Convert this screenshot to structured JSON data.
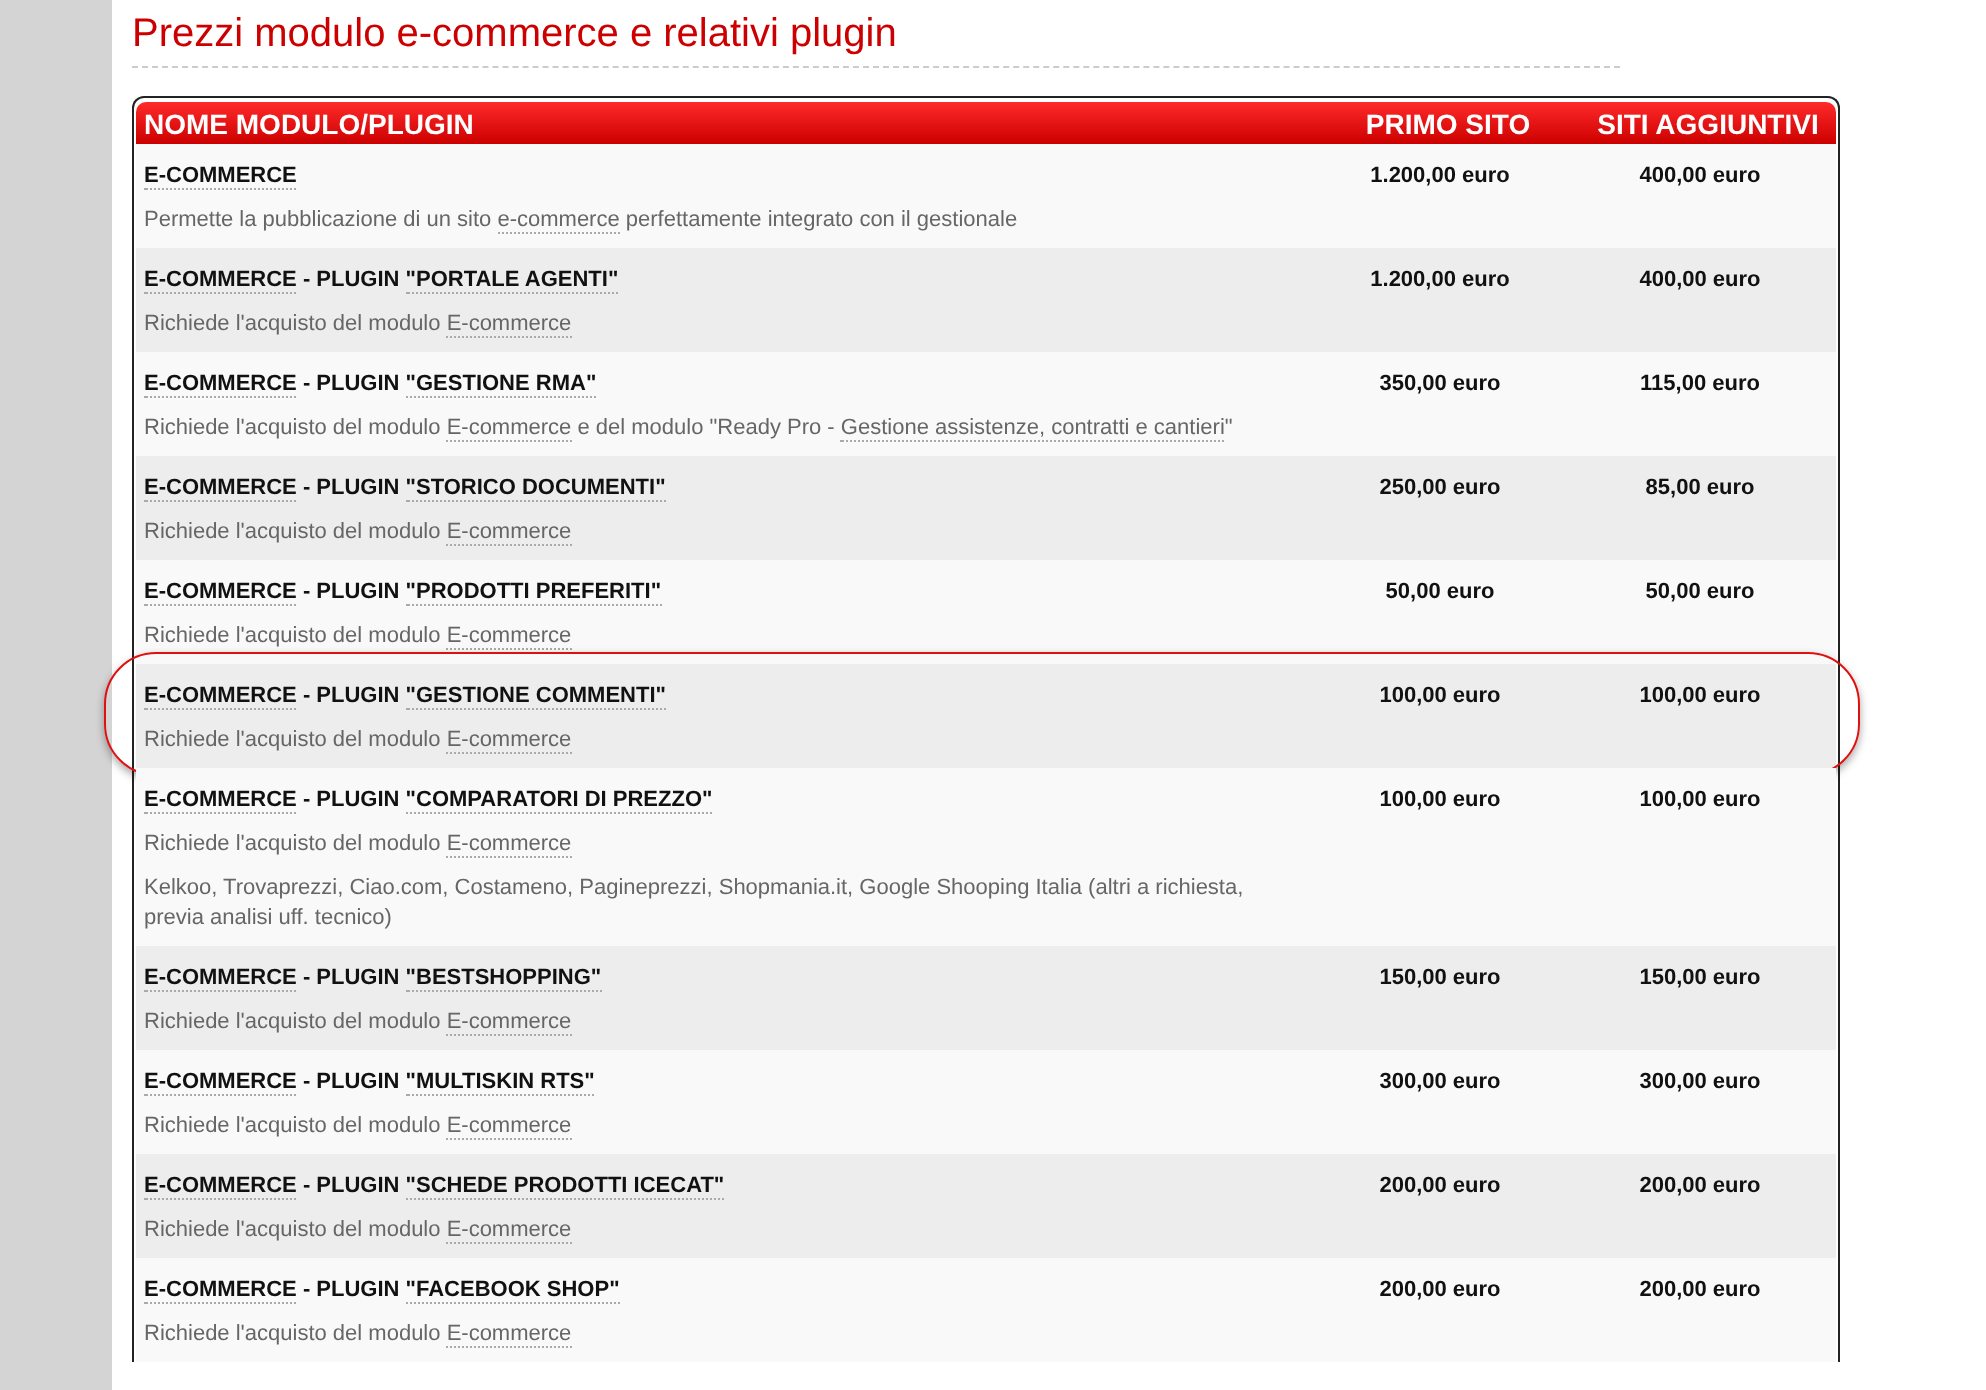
{
  "title": "Prezzi modulo e-commerce e relativi plugin",
  "table": {
    "columns": [
      "NOME MODULO/PLUGIN",
      "PRIMO SITO",
      "SITI AGGIUNTIVI"
    ],
    "rows": [
      {
        "name": [
          {
            "text": "E-COMMERCE",
            "link": true
          }
        ],
        "lines": [
          [
            {
              "text": "Permette la pubblicazione di un sito ",
              "link": false
            },
            {
              "text": "e-commerce",
              "link": true
            },
            {
              "text": " perfettamente integrato con il gestionale",
              "link": false
            }
          ]
        ],
        "primo_sito": "1.200,00 euro",
        "siti_aggiuntivi": "400,00 euro",
        "highlighted": false
      },
      {
        "name": [
          {
            "text": "E-COMMERCE",
            "link": true
          },
          {
            "text": " - PLUGIN ",
            "link": false
          },
          {
            "text": "\"PORTALE AGENTI\"",
            "link": true
          }
        ],
        "lines": [
          [
            {
              "text": "Richiede l'acquisto del modulo ",
              "link": false
            },
            {
              "text": "E-commerce",
              "link": true
            }
          ]
        ],
        "primo_sito": "1.200,00 euro",
        "siti_aggiuntivi": "400,00 euro",
        "highlighted": false
      },
      {
        "name": [
          {
            "text": "E-COMMERCE",
            "link": true
          },
          {
            "text": " - PLUGIN ",
            "link": false
          },
          {
            "text": "\"GESTIONE RMA\"",
            "link": true
          }
        ],
        "lines": [
          [
            {
              "text": "Richiede l'acquisto del modulo ",
              "link": false
            },
            {
              "text": "E-commerce",
              "link": true
            },
            {
              "text": " e del modulo \"Ready Pro - ",
              "link": false
            },
            {
              "text": "Gestione assistenze, contratti e cantieri",
              "link": true
            },
            {
              "text": "\"",
              "link": false
            }
          ]
        ],
        "primo_sito": "350,00 euro",
        "siti_aggiuntivi": "115,00 euro",
        "highlighted": false
      },
      {
        "name": [
          {
            "text": "E-COMMERCE",
            "link": true
          },
          {
            "text": " - PLUGIN ",
            "link": false
          },
          {
            "text": "\"STORICO DOCUMENTI\"",
            "link": true
          }
        ],
        "lines": [
          [
            {
              "text": "Richiede l'acquisto del modulo ",
              "link": false
            },
            {
              "text": "E-commerce",
              "link": true
            }
          ]
        ],
        "primo_sito": "250,00 euro",
        "siti_aggiuntivi": "85,00 euro",
        "highlighted": false
      },
      {
        "name": [
          {
            "text": "E-COMMERCE",
            "link": true
          },
          {
            "text": " - PLUGIN ",
            "link": false
          },
          {
            "text": "\"PRODOTTI PREFERITI\"",
            "link": true
          }
        ],
        "lines": [
          [
            {
              "text": "Richiede l'acquisto del modulo ",
              "link": false
            },
            {
              "text": "E-commerce",
              "link": true
            }
          ]
        ],
        "primo_sito": "50,00 euro",
        "siti_aggiuntivi": "50,00 euro",
        "highlighted": false
      },
      {
        "name": [
          {
            "text": "E-COMMERCE",
            "link": true
          },
          {
            "text": " - PLUGIN ",
            "link": false
          },
          {
            "text": "\"GESTIONE COMMENTI\"",
            "link": true
          }
        ],
        "lines": [
          [
            {
              "text": "Richiede l'acquisto del modulo ",
              "link": false
            },
            {
              "text": "E-commerce",
              "link": true
            }
          ]
        ],
        "primo_sito": "100,00 euro",
        "siti_aggiuntivi": "100,00 euro",
        "highlighted": true
      },
      {
        "name": [
          {
            "text": "E-COMMERCE",
            "link": true
          },
          {
            "text": " - PLUGIN ",
            "link": false
          },
          {
            "text": "\"COMPARATORI DI PREZZO\"",
            "link": true
          }
        ],
        "lines": [
          [
            {
              "text": "Richiede l'acquisto del modulo ",
              "link": false
            },
            {
              "text": "E-commerce",
              "link": true
            }
          ],
          [
            {
              "text": "Kelkoo, Trovaprezzi, Ciao.com, Costameno, Pagineprezzi, Shopmania.it, Google Shooping Italia (altri a richiesta, previa analisi uff. tecnico)",
              "link": false
            }
          ]
        ],
        "primo_sito": "100,00 euro",
        "siti_aggiuntivi": "100,00 euro",
        "highlighted": false
      },
      {
        "name": [
          {
            "text": "E-COMMERCE",
            "link": true
          },
          {
            "text": " - PLUGIN ",
            "link": false
          },
          {
            "text": "\"BESTSHOPPING\"",
            "link": true
          }
        ],
        "lines": [
          [
            {
              "text": "Richiede l'acquisto del modulo ",
              "link": false
            },
            {
              "text": "E-commerce",
              "link": true
            }
          ]
        ],
        "primo_sito": "150,00 euro",
        "siti_aggiuntivi": "150,00 euro",
        "highlighted": false
      },
      {
        "name": [
          {
            "text": "E-COMMERCE",
            "link": true
          },
          {
            "text": " - PLUGIN ",
            "link": false
          },
          {
            "text": "\"MULTISKIN RTS\"",
            "link": true
          }
        ],
        "lines": [
          [
            {
              "text": "Richiede l'acquisto del modulo ",
              "link": false
            },
            {
              "text": "E-commerce",
              "link": true
            }
          ]
        ],
        "primo_sito": "300,00 euro",
        "siti_aggiuntivi": "300,00 euro",
        "highlighted": false
      },
      {
        "name": [
          {
            "text": "E-COMMERCE",
            "link": true
          },
          {
            "text": " - PLUGIN ",
            "link": false
          },
          {
            "text": "\"SCHEDE PRODOTTI ICECAT\"",
            "link": true
          }
        ],
        "lines": [
          [
            {
              "text": "Richiede l'acquisto del modulo ",
              "link": false
            },
            {
              "text": "E-commerce",
              "link": true
            }
          ]
        ],
        "primo_sito": "200,00 euro",
        "siti_aggiuntivi": "200,00 euro",
        "highlighted": false
      },
      {
        "name": [
          {
            "text": "E-COMMERCE",
            "link": true
          },
          {
            "text": " - PLUGIN ",
            "link": false
          },
          {
            "text": "\"FACEBOOK SHOP\"",
            "link": true
          }
        ],
        "lines": [
          [
            {
              "text": "Richiede l'acquisto del modulo ",
              "link": false
            },
            {
              "text": "E-commerce",
              "link": true
            }
          ]
        ],
        "primo_sito": "200,00 euro",
        "siti_aggiuntivi": "200,00 euro",
        "highlighted": false
      }
    ]
  }
}
